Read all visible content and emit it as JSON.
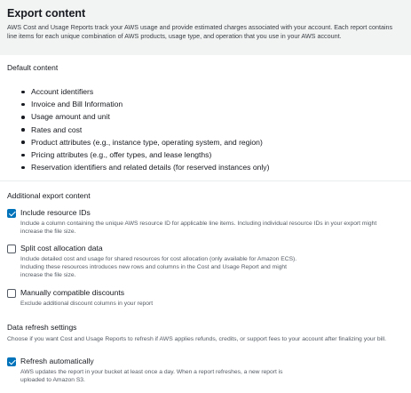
{
  "header": {
    "title": "Export content",
    "description": "AWS Cost and Usage Reports track your AWS usage and provide estimated charges associated with your account. Each report contains line items for each unique combination of AWS products, usage type, and operation that you use in your AWS account."
  },
  "default_content": {
    "title": "Default content",
    "items": [
      "Account identifiers",
      "Invoice and Bill Information",
      "Usage amount and unit",
      "Rates and cost",
      "Product attributes (e.g., instance type, operating system, and region)",
      "Pricing attributes (e.g., offer types, and lease lengths)",
      "Reservation identifiers and related details (for reserved instances only)"
    ]
  },
  "additional": {
    "title": "Additional export content",
    "options": [
      {
        "label": "Include resource IDs",
        "checked": true,
        "description": "Include a column containing the unique AWS resource ID for applicable line items. Including individual resource IDs in your export might increase the file size."
      },
      {
        "label": "Split cost allocation data",
        "checked": false,
        "description": "Include detailed cost and usage for shared resources for cost allocation (only available for Amazon ECS). Including these resources introduces new rows and columns in the Cost and Usage Report and might increase the file size."
      },
      {
        "label": "Manually compatible discounts",
        "checked": false,
        "description": "Exclude additional discount columns in your report"
      }
    ]
  },
  "refresh": {
    "title": "Data refresh settings",
    "description": "Choose if you want Cost and Usage Reports to refresh if AWS applies refunds, credits, or support fees to your account after finalizing your bill.",
    "option": {
      "label": "Refresh automatically",
      "checked": true,
      "description": "AWS updates the report in your bucket at least once a day. When a report refreshes, a new report is uploaded to Amazon S3."
    }
  },
  "colors": {
    "checkbox_checked": "#0073bb",
    "header_background": "#f2f3f3"
  }
}
